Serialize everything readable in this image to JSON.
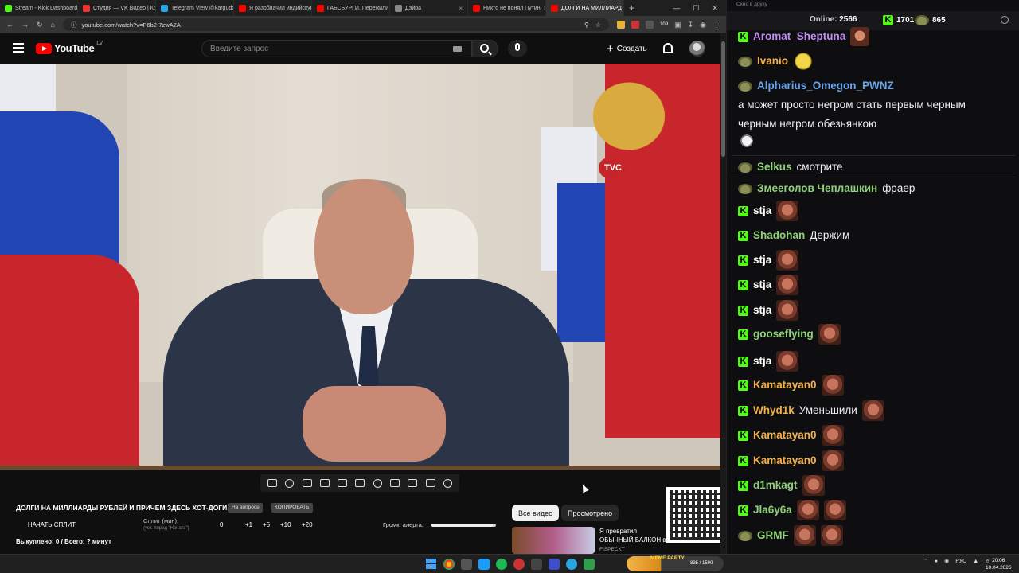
{
  "browser": {
    "tabs": [
      {
        "label": "Stream - Kick Dashboard",
        "color": "#53fc18"
      },
      {
        "label": "Студия — VK Видео | Кон",
        "color": "#e33"
      },
      {
        "label": "Telegram View @kargudo",
        "color": "#2aa3e0"
      },
      {
        "label": "Я разоблачил индийскую",
        "color": "#f00"
      },
      {
        "label": "ГАБСБУРГИ. Пережили",
        "color": "#f00"
      },
      {
        "label": "Дэйра",
        "color": "#888"
      },
      {
        "label": "Никто не понял Путин",
        "color": "#f00"
      },
      {
        "label": "ДОЛГИ НА МИЛЛИАРД",
        "color": "#f00"
      }
    ],
    "url": "youtube.com/watch?v=P6b2-7zwA2A",
    "badge_count": "109"
  },
  "youtube": {
    "logo_text": "YouTube",
    "region": "LV",
    "search_placeholder": "Введите запрос",
    "create_label": "Создать"
  },
  "video": {
    "overlay_logo": "TVC"
  },
  "player": {
    "title": "ДОЛГИ НА МИЛЛИАРДЫ РУБЛЕЙ И ПРИЧЁМ ЗДЕСЬ ХОТ-ДОГИ",
    "tag_ordered": "На вопросе",
    "tag_copy": "КОПИРОВАТЬ",
    "start_split": "НАЧАТЬ СПЛИТ",
    "split_label": "Сплит (мин):",
    "split_hint": "(уст. перед \"Начать\")",
    "split_values": [
      "0",
      "+1",
      "+5",
      "+10",
      "+20"
    ],
    "alert_volume_label": "Громк. алерта:",
    "alert_volume": 0.95,
    "bought": "Выкуплено: 0 / Всего: ? минут",
    "chip_all": "Все видео",
    "chip_watched": "Просмотрено",
    "rec_title": "Я превратил ОБЫЧНЫЙ БАЛКОН в ГЕЙМЕРСКИЙ",
    "rec_channel": "FISPECKT"
  },
  "chat": {
    "window_title": "Окно в друку",
    "online_label": "Online:",
    "online_count": "2566",
    "kick_count": "1701",
    "viewer_count": "865",
    "messages": [
      {
        "badge": "kick",
        "user": "Aromat_Sheptuna",
        "color": "#c18cf2",
        "text": "",
        "emotes": [
          "aromat"
        ]
      },
      {
        "badge": "frog",
        "user": "Ivanio",
        "color": "#f2b04b",
        "text": "",
        "emotes": [
          "smile"
        ]
      },
      {
        "badge": "frog",
        "user": "Alpharius_Omegon_PWNZ",
        "color": "#6aa4e8",
        "text": "а может просто негром стать первым черным черным негром обезьянкою",
        "emotes": []
      },
      {
        "badge": "frog",
        "user": "Selkus",
        "color": "#8fd17a",
        "text": "смотрите",
        "emotes": []
      },
      {
        "badge": "frog",
        "user": "Змееголов Чеплашкин",
        "color": "#8fd17a",
        "text": "фраер",
        "emotes": []
      },
      {
        "badge": "kick",
        "user": "stja",
        "color": "#ffffff",
        "text": "",
        "emotes": [
          "face"
        ]
      },
      {
        "badge": "kick",
        "user": "Shadohan",
        "color": "#8fd17a",
        "text": "Держим",
        "emotes": []
      },
      {
        "badge": "kick",
        "user": "stja",
        "color": "#ffffff",
        "text": "",
        "emotes": [
          "face"
        ]
      },
      {
        "badge": "kick",
        "user": "stja",
        "color": "#ffffff",
        "text": "",
        "emotes": [
          "face"
        ]
      },
      {
        "badge": "kick",
        "user": "stja",
        "color": "#ffffff",
        "text": "",
        "emotes": [
          "face"
        ]
      },
      {
        "badge": "kick",
        "user": "gooseflying",
        "color": "#8fd17a",
        "text": "",
        "emotes": [
          "face"
        ]
      },
      {
        "badge": "kick",
        "user": "stja",
        "color": "#ffffff",
        "text": "",
        "emotes": [
          "face"
        ]
      },
      {
        "badge": "kick",
        "user": "Kamatayan0",
        "color": "#f2b04b",
        "text": "",
        "emotes": [
          "face"
        ]
      },
      {
        "badge": "kick",
        "user": "Whyd1k",
        "color": "#f2b04b",
        "text": "Уменьшили",
        "emotes": [
          "face"
        ]
      },
      {
        "badge": "kick",
        "user": "Kamatayan0",
        "color": "#f2b04b",
        "text": "",
        "emotes": [
          "face"
        ]
      },
      {
        "badge": "kick",
        "user": "Kamatayan0",
        "color": "#f2b04b",
        "text": "",
        "emotes": [
          "face"
        ]
      },
      {
        "badge": "kick",
        "user": "d1mkagt",
        "color": "#8fd17a",
        "text": "",
        "emotes": [
          "face"
        ]
      },
      {
        "badge": "kick",
        "user": "Jla6y6a",
        "color": "#8fd17a",
        "text": "",
        "emotes": [
          "face",
          "face"
        ]
      },
      {
        "badge": "frog",
        "user": "GRMF",
        "color": "#8fd17a",
        "text": "",
        "emotes": [
          "face",
          "face"
        ]
      }
    ]
  },
  "taskbar": {
    "meme_label": "MEME PARTY",
    "meme_count": "835 / 1590",
    "lang": "РУС",
    "time": "20:06",
    "date": "10.04.2026"
  }
}
